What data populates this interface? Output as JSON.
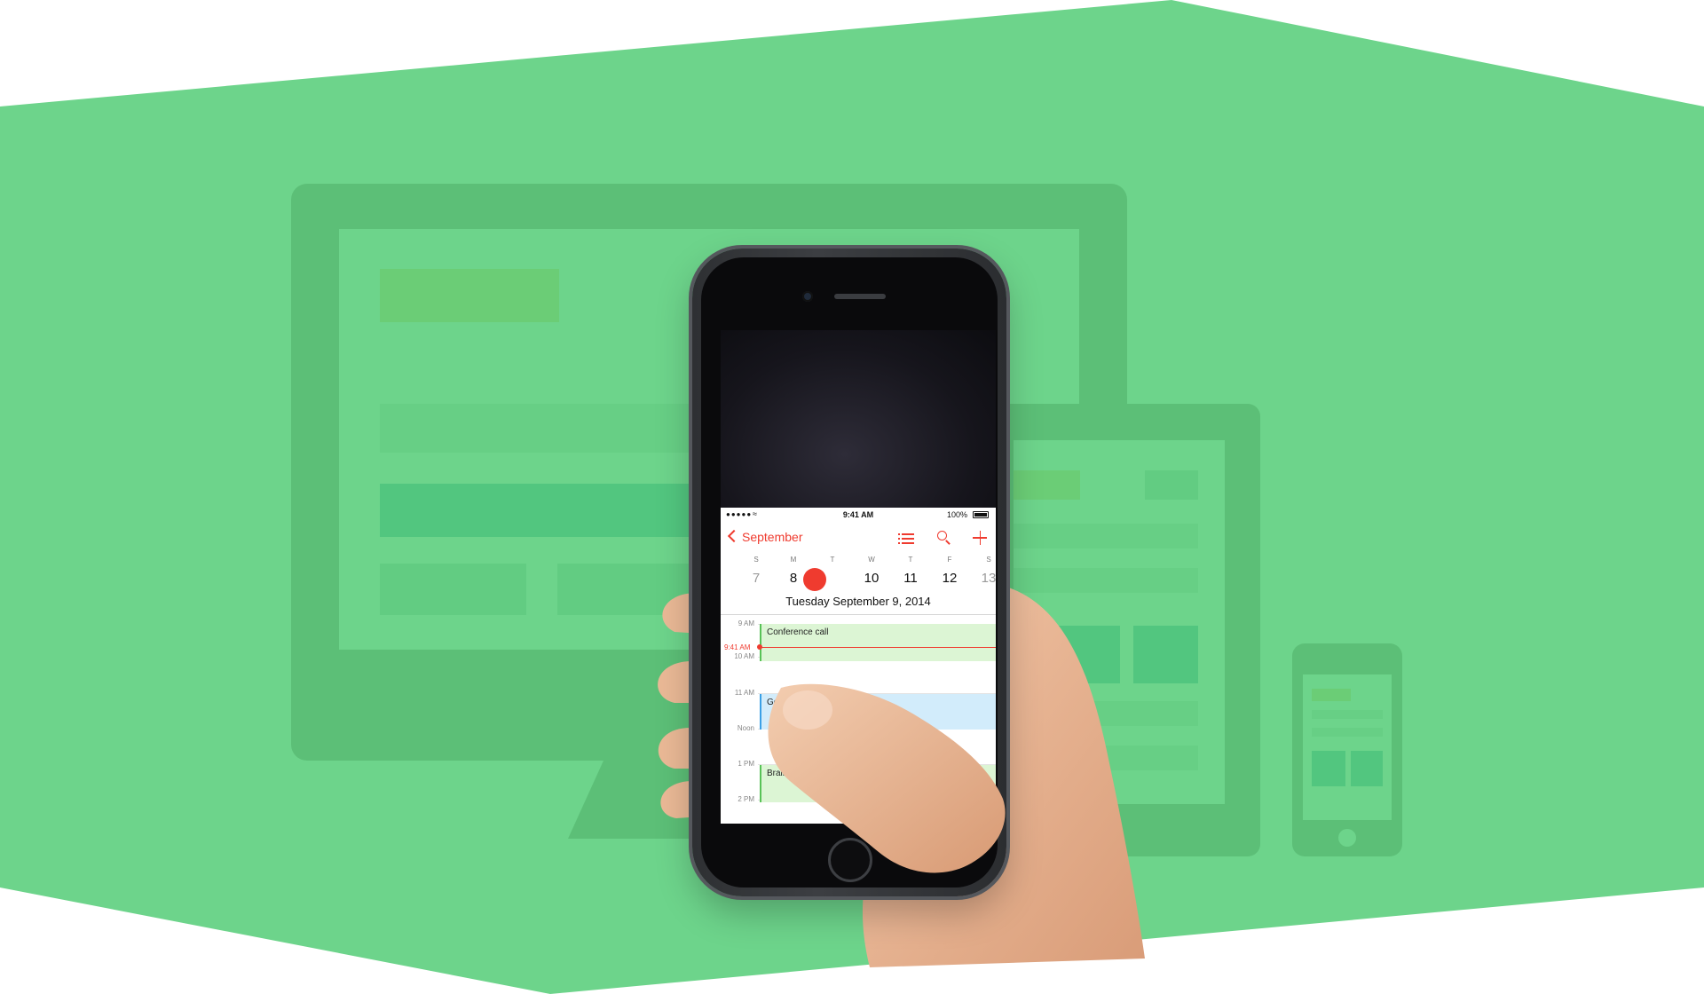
{
  "colors": {
    "background_band": "#6dd48b",
    "device_shape": "#5cbf77",
    "device_shape_dark": "#4ec981",
    "accent_red": "#ef3b2f",
    "event_green": "#dcf5d4",
    "event_blue": "#d2ecfb"
  },
  "phone": {
    "status_bar": {
      "signal": "●●●●●",
      "time": "9:41 AM",
      "battery": "100%"
    },
    "nav": {
      "back_label": "September",
      "icons": [
        "list-icon",
        "search-icon",
        "add-icon"
      ]
    },
    "week": [
      {
        "letter": "S",
        "num": "7",
        "muted": true
      },
      {
        "letter": "M",
        "num": "8",
        "muted": false
      },
      {
        "letter": "T",
        "num": "9",
        "today": true
      },
      {
        "letter": "W",
        "num": "10",
        "muted": false
      },
      {
        "letter": "T",
        "num": "11",
        "muted": false
      },
      {
        "letter": "F",
        "num": "12",
        "muted": false
      },
      {
        "letter": "S",
        "num": "13",
        "muted": true
      }
    ],
    "selected_date": "Tuesday   September 9, 2014",
    "timeline": {
      "hours": [
        "9 AM",
        "10 AM",
        "11 AM",
        "Noon",
        "1 PM",
        "2 PM"
      ],
      "now_label": "9:41 AM",
      "events": [
        {
          "title": "Conference call",
          "color": "green"
        },
        {
          "title": "Go",
          "color": "blue"
        },
        {
          "title": "Brainstorming s",
          "color": "green"
        }
      ]
    }
  }
}
